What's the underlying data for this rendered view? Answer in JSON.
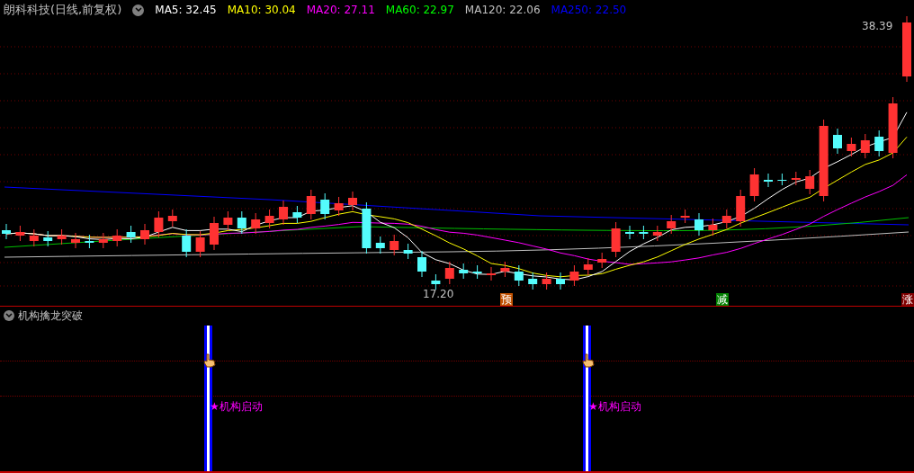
{
  "header": {
    "title": "朗科科技(日线,前复权)",
    "indicators": [
      {
        "label": "MA5: 32.45",
        "color": "#ffffff"
      },
      {
        "label": "MA10: 30.04",
        "color": "#ffff00"
      },
      {
        "label": "MA20: 27.11",
        "color": "#ff00ff"
      },
      {
        "label": "MA60: 22.97",
        "color": "#00ff00"
      },
      {
        "label": "MA120: 22.06",
        "color": "#c0c0c0"
      },
      {
        "label": "MA250: 22.50",
        "color": "#0000ff"
      }
    ]
  },
  "price_labels": {
    "high": "38.39",
    "low": "17.20"
  },
  "markers": [
    {
      "text": "预",
      "color": "#c05000"
    },
    {
      "text": "减",
      "color": "#008000"
    },
    {
      "text": "涨",
      "color": "#800000"
    }
  ],
  "sub_panel": {
    "title": "机构擒龙突破",
    "signals": [
      {
        "text": "★机构启动"
      },
      {
        "text": "★机构启动"
      }
    ]
  }
}
